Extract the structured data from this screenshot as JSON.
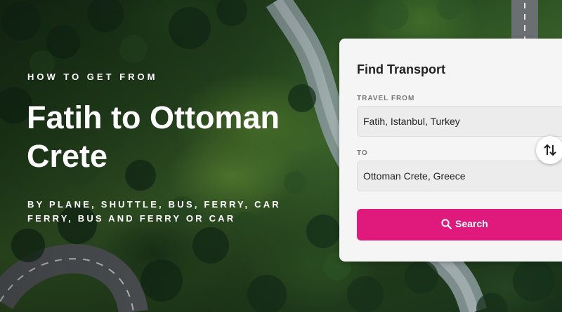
{
  "hero": {
    "eyebrow": "HOW TO GET FROM",
    "title": "Fatih to Ottoman Crete",
    "modes": "BY PLANE, SHUTTLE, BUS, FERRY, CAR FERRY, BUS AND FERRY OR CAR"
  },
  "finder": {
    "title": "Find Transport",
    "from_label": "TRAVEL FROM",
    "from_value": "Fatih, Istanbul, Turkey",
    "to_label": "TO",
    "to_value": "Ottoman Crete, Greece",
    "swap_icon": "swap-vertical-icon",
    "search_label": "Search",
    "search_icon": "search-icon"
  },
  "colors": {
    "accent": "#e0197d",
    "card_bg": "#f5f5f5"
  }
}
